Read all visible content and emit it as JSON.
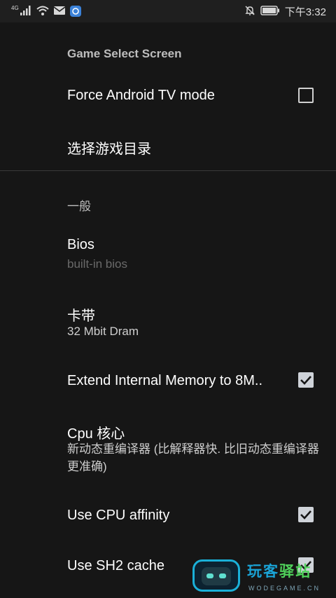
{
  "status_bar": {
    "network_label": "4G",
    "time": "下午3:32",
    "icons": [
      "signal-icon",
      "wifi-icon",
      "mail-icon",
      "app-icon",
      "bell-off-icon",
      "battery-icon"
    ]
  },
  "settings": {
    "game_select_category": "Game Select Screen",
    "force_tv_mode": {
      "title": "Force Android TV mode",
      "checked": false
    },
    "select_game_dir": {
      "title": "选择游戏目录"
    },
    "general_category": "一般",
    "bios": {
      "title": "Bios",
      "summary": "built-in bios"
    },
    "cartridge": {
      "title": "卡带",
      "summary": "32 Mbit Dram"
    },
    "extend_memory": {
      "title": "Extend Internal Memory to 8M..",
      "checked": true
    },
    "cpu_core": {
      "title": "Cpu 核心",
      "summary": "新动态重编译器 (比解释器快. 比旧动态重编译器更准确)"
    },
    "cpu_affinity": {
      "title": "Use CPU affinity",
      "checked": true
    },
    "sh2_cache": {
      "title": "Use SH2 cache",
      "checked": true
    }
  },
  "watermark": {
    "text_blue": "玩客",
    "text_green": "驿站",
    "url": "WODEGAME.CN"
  },
  "colors": {
    "background": "#161616",
    "status_bar": "#1f1f1f",
    "checkbox_checked": "#cfd3d9",
    "summary_disabled": "#6a6a6a"
  }
}
